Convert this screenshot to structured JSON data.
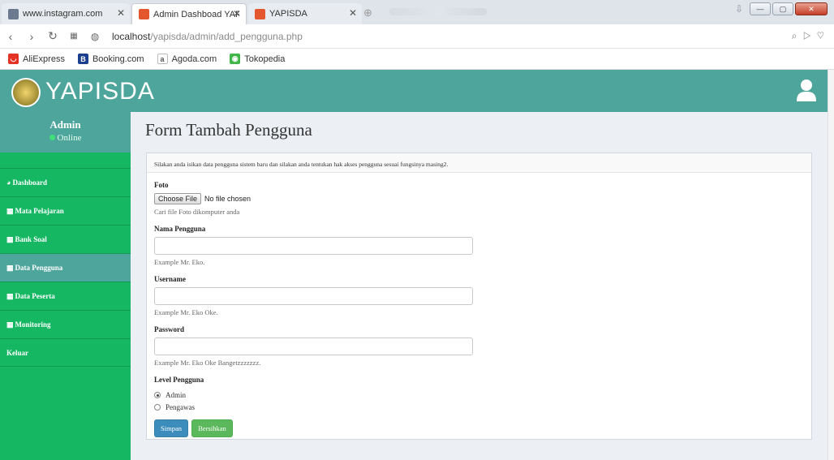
{
  "browser": {
    "tabs": [
      {
        "title": "www.instagram.com",
        "active": false
      },
      {
        "title": "Admin Dashboad YAPISDA",
        "active": true
      },
      {
        "title": "YAPISDA",
        "active": false
      }
    ],
    "url_host": "localhost",
    "url_path": "/yapisda/admin/add_pengguna.php",
    "bookmarks": [
      "AliExpress",
      "Booking.com",
      "Agoda.com",
      "Tokopedia"
    ]
  },
  "app": {
    "brand": "YAPISDA",
    "primary_color": "#4ea59c",
    "sidebar_color": "#15b763"
  },
  "user": {
    "name": "Admin",
    "status": "Online"
  },
  "sidebar": {
    "items": [
      {
        "label": "Dashboard",
        "icon": "dashboard-icon",
        "active": false
      },
      {
        "label": "Mata Pelajaran",
        "icon": "table-icon",
        "active": false
      },
      {
        "label": "Bank Soal",
        "icon": "table-icon",
        "active": false
      },
      {
        "label": "Data Pengguna",
        "icon": "table-icon",
        "active": true
      },
      {
        "label": "Data Peserta",
        "icon": "table-icon",
        "active": false
      },
      {
        "label": "Monitoring",
        "icon": "table-icon",
        "active": false
      },
      {
        "label": "Keluar",
        "icon": "",
        "active": false
      }
    ]
  },
  "page": {
    "title": "Form Tambah Pengguna",
    "info": "Silakan anda isikan data pengguna sistem baru dan silakan anda tentukan hak akses pengguna sesuai fungsinya masing2."
  },
  "form": {
    "foto": {
      "label": "Foto",
      "button": "Choose File",
      "status": "No file chosen",
      "help": "Cari file Foto dikomputer anda"
    },
    "nama": {
      "label": "Nama Pengguna",
      "value": "",
      "help": "Example Mr. Eko."
    },
    "username": {
      "label": "Username",
      "value": "",
      "help": "Example Mr. Eko Oke."
    },
    "password": {
      "label": "Password",
      "value": "",
      "help": "Example Mr. Eko Oke Bangetzzzzzzz."
    },
    "level": {
      "label": "Level Pengguna",
      "options": [
        {
          "label": "Admin",
          "selected": true
        },
        {
          "label": "Pengawas",
          "selected": false
        }
      ]
    },
    "submit_label": "Simpan",
    "reset_label": "Bersihkan"
  }
}
